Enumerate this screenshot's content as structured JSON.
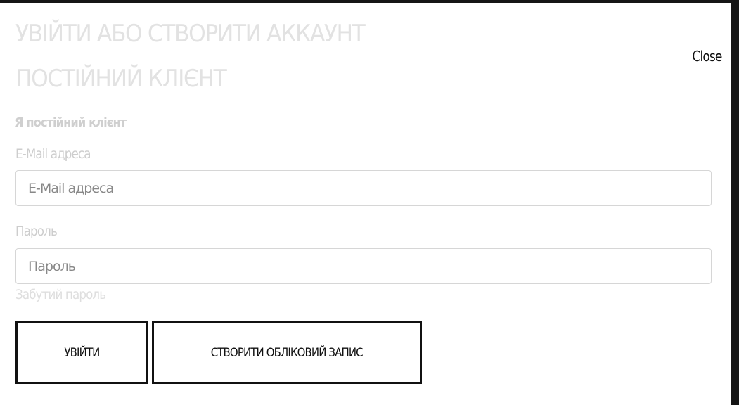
{
  "modal": {
    "title": "УВІЙТИ АБО СТВОРИТИ АККАУНТ",
    "subtitle": "ПОСТІЙНИЙ КЛІЄНТ",
    "close_label": "Close",
    "section_heading": "Я постійний клієнт"
  },
  "form": {
    "email_label": "E-Mail адреса",
    "email_placeholder": "E-Mail адреса",
    "email_value": "",
    "password_label": "Пароль",
    "password_placeholder": "Пароль",
    "password_value": "",
    "forgot_link": "Забутий пароль"
  },
  "buttons": {
    "login_label": "УВІЙТИ",
    "create_label": "СТВОРИТИ ОБЛІКОВИЙ ЗАПИС"
  },
  "colors": {
    "backdrop": "#151515",
    "modal_bg": "#ffffff",
    "title_text": "#e2e2e2",
    "button_border": "#111111"
  }
}
